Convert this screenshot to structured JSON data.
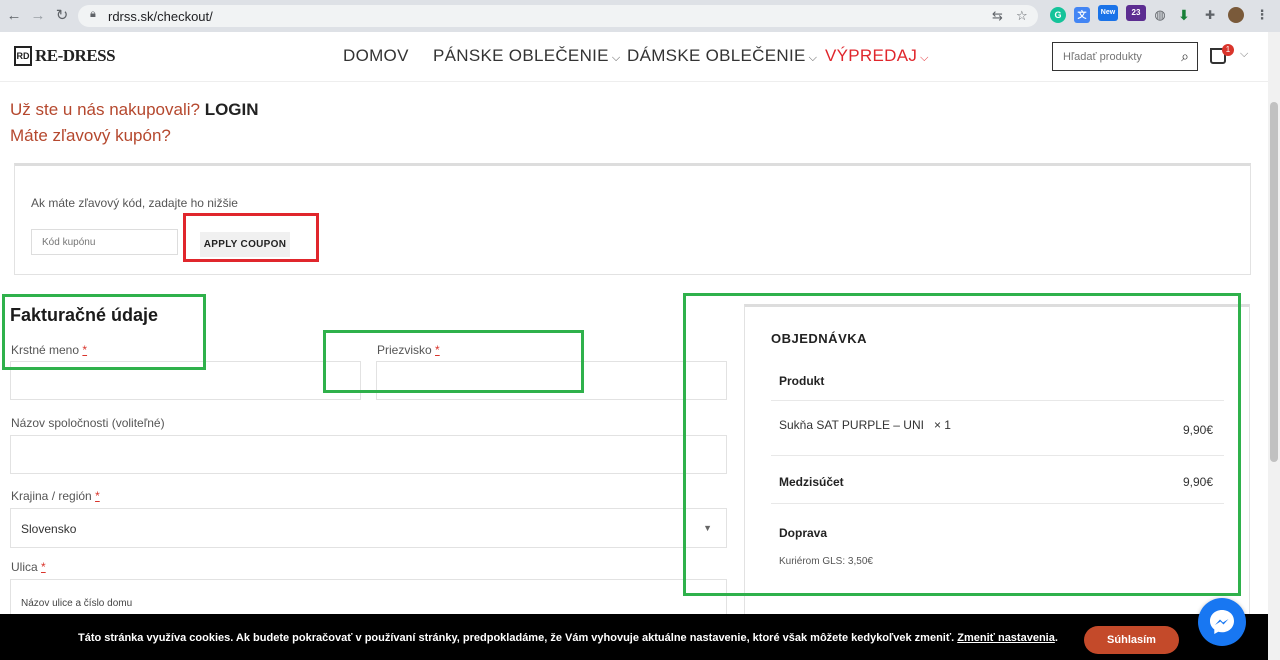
{
  "browser": {
    "url": "rdrss.sk/checkout/",
    "ext_badge_new": "New",
    "ext_badge_count": "23"
  },
  "header": {
    "logo_text": "RE-DRESS",
    "logo_mark": "RD",
    "menu": [
      {
        "label": "DOMOV"
      },
      {
        "label": "PÁNSKE OBLEČENIE"
      },
      {
        "label": "DÁMSKE OBLEČENIE"
      },
      {
        "label": "VÝPREDAJ"
      }
    ],
    "sale_color": "#e0262c",
    "search_placeholder": "Hľadať produkty",
    "cart_count": "1"
  },
  "notices": {
    "returning": "Už ste u nás nakupovali?",
    "login": "LOGIN",
    "coupon": "Máte zľavový kupón?"
  },
  "coupon": {
    "hint": "Ak máte zľavový kód, zadajte ho nižšie",
    "placeholder": "Kód kupónu",
    "apply_label": "APPLY COUPON"
  },
  "billing": {
    "title": "Fakturačné údaje",
    "first_name_label": "Krstné meno",
    "last_name_label": "Priezvisko",
    "company_label": "Názov spoločnosti (voliteľné)",
    "country_label": "Krajina / región",
    "country_value": "Slovensko",
    "street_label": "Ulica",
    "street_placeholder": "Názov ulice a číslo domu",
    "required_mark": "*"
  },
  "order": {
    "title": "OBJEDNÁVKA",
    "product_header": "Produkt",
    "item_name": "Sukňa SAT PURPLE – UNI",
    "item_qty": "× 1",
    "item_price": "9,90€",
    "subtotal_label": "Medzisúčet",
    "subtotal_value": "9,90€",
    "shipping_label": "Doprava",
    "shipping_method": "Kuriérom GLS: 3,50€"
  },
  "cookie": {
    "text": "Táto stránka využíva cookies. Ak budete pokračovať v používaní stránky, predpokladáme, že Vám vyhovuje aktuálne nastavenie, ktoré však môžete kedykoľvek zmeniť.",
    "link": "Zmeniť nastavenia",
    "period": ".",
    "accept": "Súhlasím"
  },
  "colors": {
    "accent": "#b5482e",
    "highlight_red": "#e0262c",
    "highlight_green": "#2fb14b"
  }
}
